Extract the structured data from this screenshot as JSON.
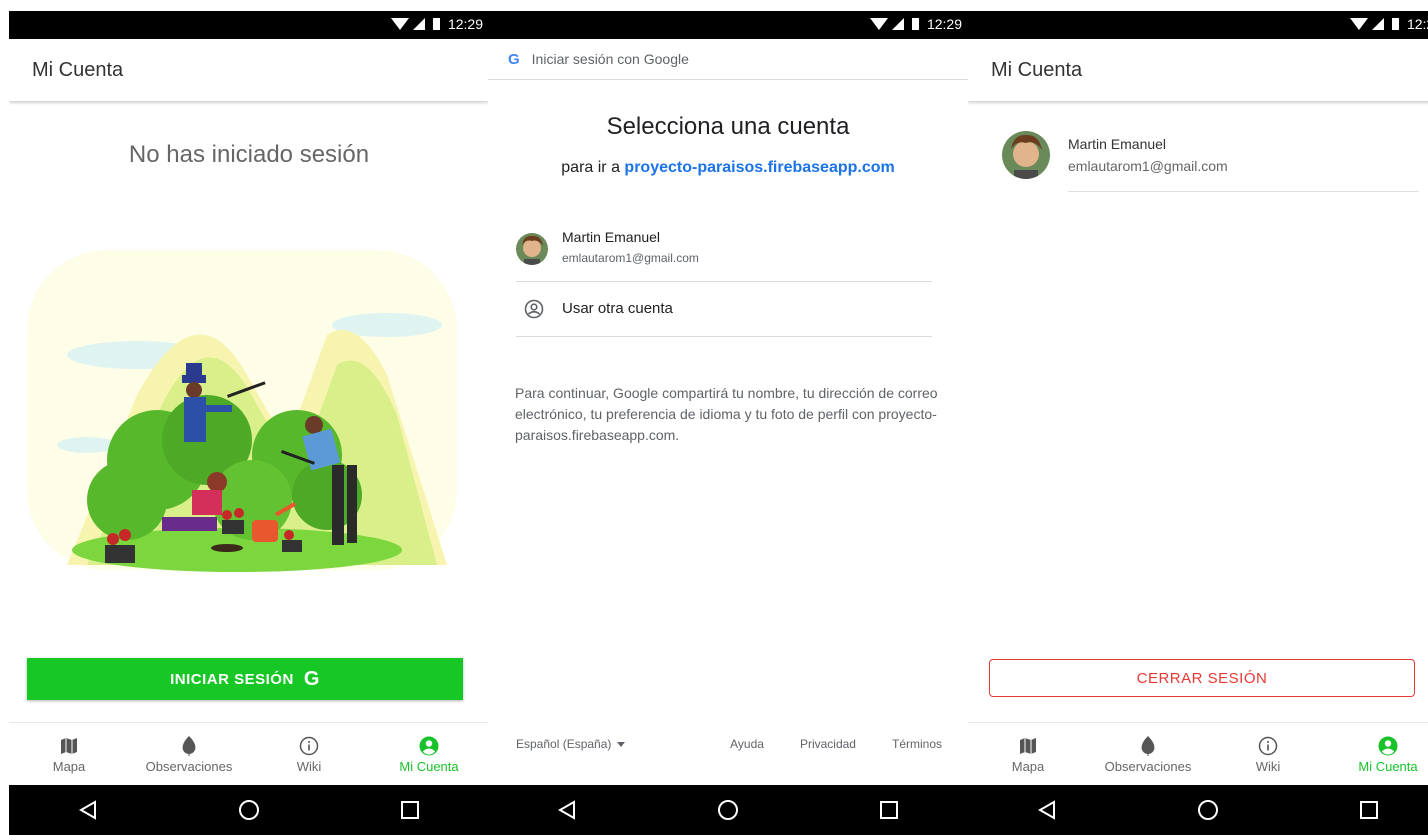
{
  "status_time": "12:29",
  "screen1": {
    "title": "Mi Cuenta",
    "heading": "No has iniciado sesión",
    "signin_label": "INICIAR SESIÓN",
    "signin_icon": "G"
  },
  "screen2": {
    "header_logo": "G",
    "header_text": "Iniciar sesión con Google",
    "title": "Selecciona una cuenta",
    "subtitle_prefix": "para ir a",
    "subtitle_link": "proyecto-paraisos.firebaseapp.com",
    "account_name": "Martin Emanuel",
    "account_email": "emlautarom1@gmail.com",
    "other_account": "Usar otra cuenta",
    "info": "Para continuar, Google compartirá tu nombre, tu dirección de correo electrónico, tu preferencia de idioma y tu foto de perfil con proyecto-paraisos.firebaseapp.com.",
    "language": "Español (España)",
    "footer_links": [
      "Ayuda",
      "Privacidad",
      "Términos"
    ]
  },
  "screen3": {
    "title": "Mi Cuenta",
    "name": "Martin Emanuel",
    "email": "emlautarom1@gmail.com",
    "logout_label": "CERRAR SESIÓN"
  },
  "tabs": [
    "Mapa",
    "Observaciones",
    "Wiki",
    "Mi Cuenta"
  ],
  "colors": {
    "accent_green": "#17c726",
    "google_blue": "#1a73e8",
    "logout_red": "#e53935"
  }
}
